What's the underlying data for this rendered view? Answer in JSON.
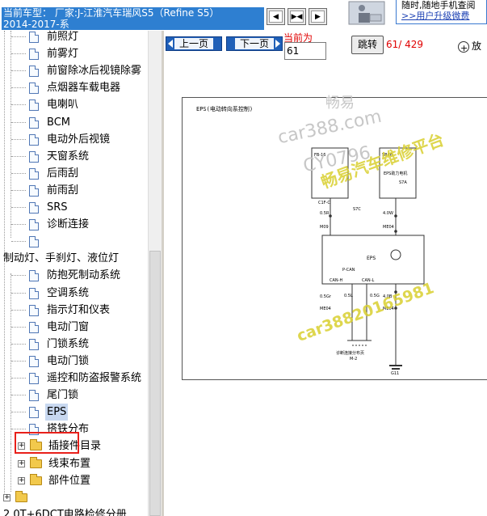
{
  "header": {
    "vehicle_line1": "当前车型： 厂家:J-江淮汽车瑞风S5（Refine S5）",
    "vehicle_line2": "2014-2017-系",
    "nav_buttons": [
      "back-arrow-icon",
      "split-view-icon",
      "forward-arrow-icon"
    ],
    "ad_line1": "随时,随地手机查阅",
    "ad_line2": ">>用户升级微费"
  },
  "tree": {
    "items": [
      {
        "label": "前照灯"
      },
      {
        "label": "前雾灯"
      },
      {
        "label": "前窗除冰后视镜除雾"
      },
      {
        "label": "点烟器车载电器"
      },
      {
        "label": "电喇叭"
      },
      {
        "label": "BCM"
      },
      {
        "label": "电动外后视镜"
      },
      {
        "label": "天窗系统"
      },
      {
        "label": "后雨刮"
      },
      {
        "label": "前雨刮"
      },
      {
        "label": "SRS"
      },
      {
        "label": "诊断连接"
      },
      {
        "label": ""
      },
      {
        "label": "制动灯、手刹灯、液位灯"
      },
      {
        "label": "防抱死制动系统"
      },
      {
        "label": "空调系统"
      },
      {
        "label": "指示灯和仪表"
      },
      {
        "label": "电动门窗"
      },
      {
        "label": "门锁系统"
      },
      {
        "label": "电动门锁"
      },
      {
        "label": "遥控和防盗报警系统"
      },
      {
        "label": "尾门锁"
      },
      {
        "label": "EPS"
      },
      {
        "label": "搭铁分布"
      },
      {
        "label": "插接件目录"
      },
      {
        "label": "线束布置"
      },
      {
        "label": "部件位置"
      },
      {
        "label": ""
      },
      {
        "label": "2.0T+6DCT电路检修分册"
      }
    ]
  },
  "toolbar": {
    "prev_label": "上一页",
    "next_label": "下一页",
    "current_label": "当前为",
    "current_value": "61",
    "jump_label": "跳转",
    "page_count": "61/ 429",
    "zoom_label": "放"
  },
  "diagram": {
    "title": "EPS(电动转向系控制)",
    "eps_label": "EPS",
    "can_label": "P-CAN",
    "can_h": "CAN-H",
    "can_l": "CAN-L",
    "fuse_left_name": "FB-16",
    "fuse_right_name": "SB46",
    "fuse_right_sub": "EPS助力电机",
    "left_conn": "C1F-C",
    "ground_label": "G11",
    "diag_label": "诊断连接分布页",
    "diag_ref": "M-2",
    "wire_labels": [
      "0.5R",
      "M09",
      "4.0W",
      "ME04",
      "0.5Gr",
      "ME04",
      "4.0B",
      "ME04",
      "0.5L",
      "0.5G",
      "S7C",
      "S7A"
    ]
  },
  "watermarks": [
    "畅易",
    "car388.com",
    "CY0796",
    "畅易汽车维修平台",
    "car38820165981"
  ],
  "colors": {
    "header_blue": "#2e7fd1",
    "red_accent": "#e00000",
    "highlight": "#e8201a",
    "watermark": "#d9d030"
  }
}
